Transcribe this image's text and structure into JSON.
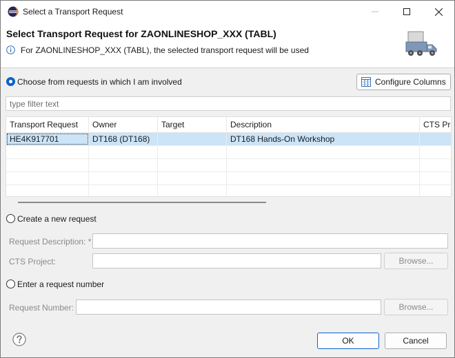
{
  "window": {
    "title": "Select a Transport Request"
  },
  "banner": {
    "title": "Select Transport Request for ZAONLINESHOP_XXX (TABL)",
    "message": "For ZAONLINESHOP_XXX (TABL), the selected transport request will be used"
  },
  "choose_section": {
    "radio_label": "Choose from requests in which I am involved",
    "selected": true,
    "configure_columns_label": "Configure Columns",
    "filter_placeholder": "type filter text"
  },
  "table": {
    "columns": [
      "Transport Request",
      "Owner",
      "Target",
      "Description",
      "CTS Proj"
    ],
    "rows": [
      [
        "HE4K917701",
        "DT168 (DT168)",
        "",
        "DT168 Hands-On Workshop",
        ""
      ]
    ],
    "selected_row": 0
  },
  "create_section": {
    "radio_label": "Create a new request",
    "selected": false,
    "description_label": "Request Description: *",
    "description_value": "",
    "project_label": "CTS Project:",
    "project_value": "",
    "browse_label": "Browse..."
  },
  "enter_section": {
    "radio_label": "Enter a request number",
    "selected": false,
    "number_label": "Request Number:",
    "number_value": "",
    "browse_label": "Browse..."
  },
  "footer": {
    "ok_label": "OK",
    "cancel_label": "Cancel"
  },
  "colors": {
    "accent": "#0a64c8",
    "selection": "#cce4f7"
  },
  "icons": {
    "app": "eclipse-icon",
    "info": "info-icon",
    "banner": "truck-icon",
    "help": "help-icon",
    "configure": "table-columns-icon"
  }
}
